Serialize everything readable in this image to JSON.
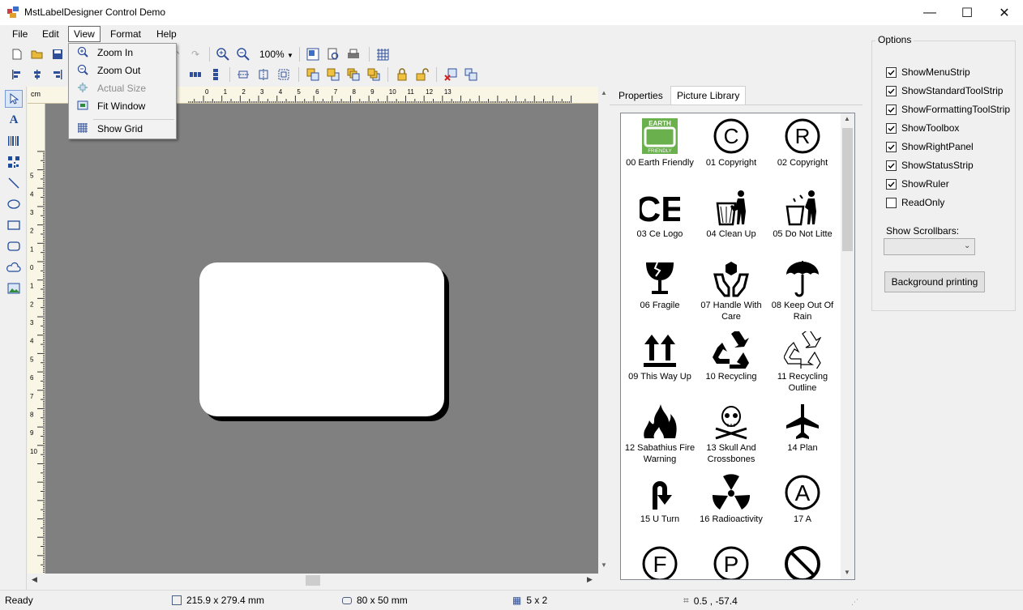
{
  "window": {
    "title": "MstLabelDesigner Control Demo",
    "minimize": "—",
    "maximize": "☐",
    "close": "✕"
  },
  "menubar": [
    "File",
    "Edit",
    "View",
    "Format",
    "Help"
  ],
  "toolbar": {
    "zoom_value": "100%"
  },
  "view_menu": [
    {
      "label": "Zoom In",
      "icon": "zoom-in-icon",
      "enabled": true
    },
    {
      "label": "Zoom Out",
      "icon": "zoom-out-icon",
      "enabled": true
    },
    {
      "label": "Actual Size",
      "icon": "actual-size-icon",
      "enabled": false
    },
    {
      "label": "Fit Window",
      "icon": "fit-window-icon",
      "enabled": true
    },
    {
      "label": "Show Grid",
      "icon": "grid-icon",
      "enabled": true
    }
  ],
  "ruler": {
    "unit": "cm",
    "top_labels": [
      "0",
      "1",
      "2",
      "3",
      "4",
      "5",
      "6",
      "7",
      "8",
      "9",
      "10",
      "11",
      "12",
      "13"
    ],
    "left_labels": [
      "5",
      "4",
      "3",
      "2",
      "1",
      "0",
      "1",
      "2",
      "3",
      "4",
      "5",
      "6",
      "7",
      "8",
      "9",
      "10"
    ]
  },
  "right_panel": {
    "tabs": [
      "Properties",
      "Picture Library"
    ],
    "active_tab": "Picture Library",
    "pictures": [
      {
        "label": "00 Earth Friendly",
        "icon": "earth-friendly-icon"
      },
      {
        "label": "01 Copyright",
        "icon": "copyright-icon"
      },
      {
        "label": "02 Copyright",
        "icon": "registered-icon"
      },
      {
        "label": "03 Ce Logo",
        "icon": "ce-logo-icon"
      },
      {
        "label": "04 Clean Up",
        "icon": "clean-up-icon"
      },
      {
        "label": "05 Do Not Litte",
        "icon": "do-not-litter-icon"
      },
      {
        "label": "06 Fragile",
        "icon": "fragile-icon"
      },
      {
        "label": "07 Handle With Care",
        "icon": "handle-with-care-icon"
      },
      {
        "label": "08 Keep Out Of Rain",
        "icon": "umbrella-icon"
      },
      {
        "label": "09 This Way Up",
        "icon": "this-way-up-icon"
      },
      {
        "label": "10 Recycling",
        "icon": "recycling-icon"
      },
      {
        "label": "11 Recycling Outline",
        "icon": "recycling-outline-icon"
      },
      {
        "label": "12 Sabathius Fire Warning",
        "icon": "fire-icon"
      },
      {
        "label": "13 Skull And Crossbones",
        "icon": "skull-icon"
      },
      {
        "label": "14 Plan",
        "icon": "airplane-icon"
      },
      {
        "label": "15 U Turn",
        "icon": "u-turn-icon"
      },
      {
        "label": "16 Radioactivity",
        "icon": "radioactivity-icon"
      },
      {
        "label": "17 A",
        "icon": "circle-a-icon"
      },
      {
        "label": "",
        "icon": "circle-f-icon"
      },
      {
        "label": "",
        "icon": "circle-p-icon"
      },
      {
        "label": "",
        "icon": "prohibited-icon"
      }
    ]
  },
  "options": {
    "title": "Options",
    "checkboxes": [
      {
        "label": "ShowMenuStrip",
        "checked": true
      },
      {
        "label": "ShowStandardToolStrip",
        "checked": true
      },
      {
        "label": "ShowFormattingToolStrip",
        "checked": true
      },
      {
        "label": "ShowToolbox",
        "checked": true
      },
      {
        "label": "ShowRightPanel",
        "checked": true
      },
      {
        "label": "ShowStatusStrip",
        "checked": true
      },
      {
        "label": "ShowRuler",
        "checked": true
      },
      {
        "label": "ReadOnly",
        "checked": false
      }
    ],
    "scrollbars_label": "Show Scrollbars:",
    "scrollbars_value": "",
    "background_button": "Background printing"
  },
  "statusbar": {
    "status": "Ready",
    "page_size": "215.9 x 279.4 mm",
    "label_size": "80 x 50 mm",
    "grid": "5 x 2",
    "position": "0.5 , -57.4"
  }
}
